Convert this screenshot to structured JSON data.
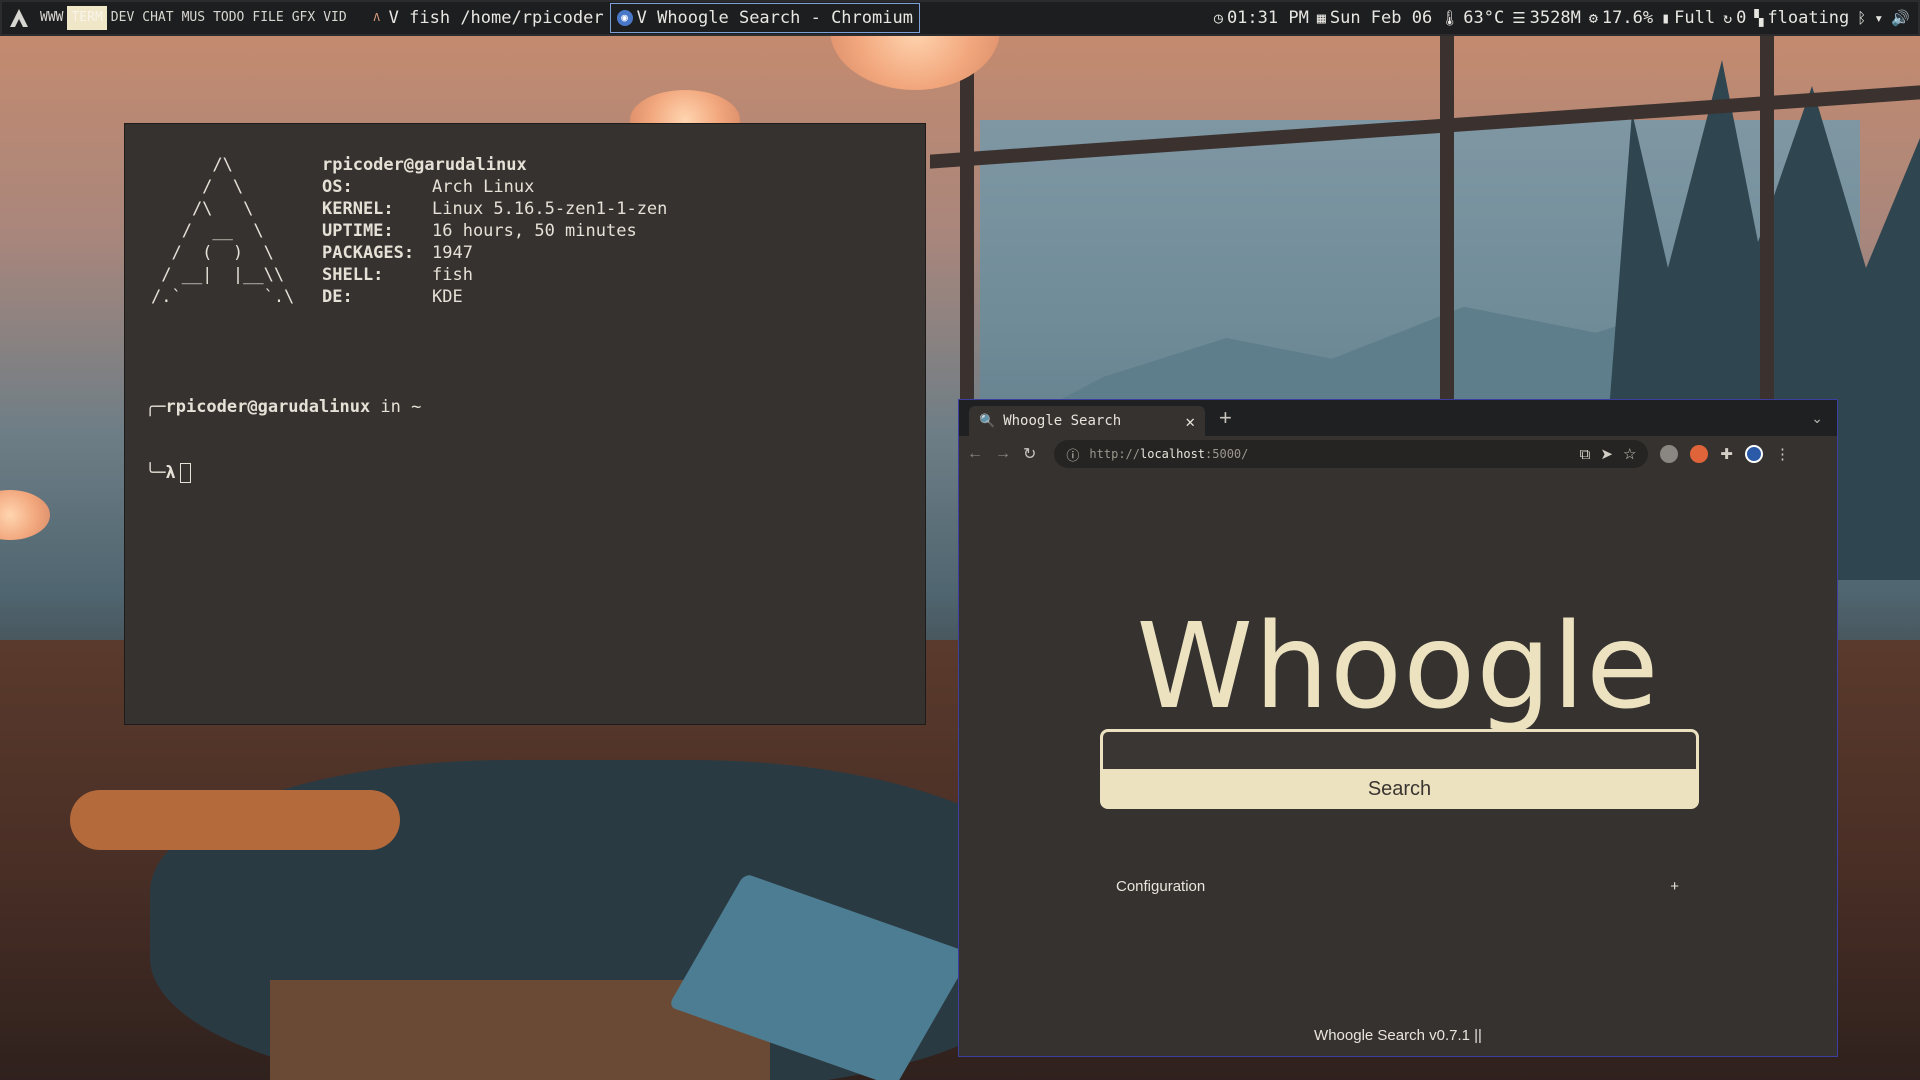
{
  "topbar": {
    "workspaces": [
      "WWW",
      "TERM",
      "DEV",
      "CHAT",
      "MUS",
      "TODO",
      "FILE",
      "GFX",
      "VID"
    ],
    "active_workspace": "TERM",
    "tasks": [
      {
        "icon": "garuda-icon",
        "label": "V fish /home/rpicoder"
      },
      {
        "icon": "chromium-icon",
        "label": "V Whoogle Search - Chromium"
      }
    ],
    "status": {
      "time": "01:31 PM",
      "date": "Sun Feb 06",
      "temp": "63°C",
      "memory": "3528M",
      "cpu": "17.6%",
      "battery": "Full",
      "updates": "0",
      "layout": "floating"
    }
  },
  "terminal": {
    "ascii_logo": "      /\\\n     /  \\\n    /\\   \\\n   /  __  \\\n  /  (  )  \\\n / __|  |__\\\\\n/.`        `.\\",
    "user_host": "rpicoder@garudalinux",
    "fetch": [
      {
        "key": "OS:",
        "value": "Arch Linux"
      },
      {
        "key": "KERNEL:",
        "value": "Linux 5.16.5-zen1-1-zen"
      },
      {
        "key": "UPTIME:",
        "value": "16 hours, 50 minutes"
      },
      {
        "key": "PACKAGES:",
        "value": "1947"
      },
      {
        "key": "SHELL:",
        "value": "fish"
      },
      {
        "key": "DE:",
        "value": "KDE"
      }
    ],
    "prompt_user": "rpicoder@garudalinux",
    "prompt_in": " in ",
    "prompt_dir": "~",
    "prompt_symbol": "λ"
  },
  "browser": {
    "tab_title": "Whoogle Search",
    "url_scheme": "http://",
    "url_host": "localhost",
    "url_rest": ":5000/",
    "wordmark": "Whoogle",
    "search_button": "Search",
    "search_value": "",
    "config_label": "Configuration",
    "config_toggle": "+",
    "footer": "Whoogle Search v0.7.1 ||"
  },
  "colors": {
    "accent": "#ede2c0",
    "page_bg": "#353230",
    "bar_bg": "#1d1e20"
  }
}
